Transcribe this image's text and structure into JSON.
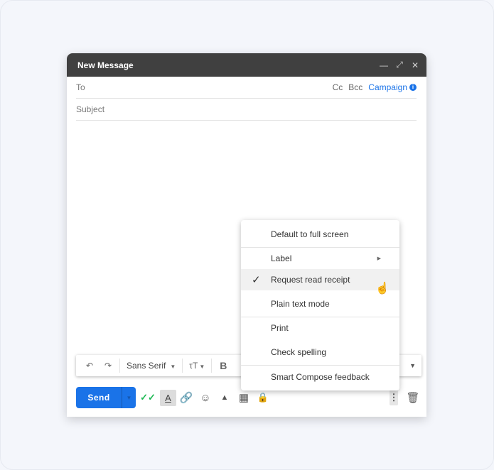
{
  "window": {
    "title": "New Message",
    "controls": [
      "minimize-icon",
      "fullscreen-icon",
      "close-icon"
    ]
  },
  "fields": {
    "to_label": "To",
    "cc": "Cc",
    "bcc": "Bcc",
    "campaign": "Campaign",
    "subject_placeholder": "Subject"
  },
  "format_toolbar": {
    "font": "Sans Serif",
    "bold": "B"
  },
  "bottom_toolbar": {
    "send_label": "Send"
  },
  "menu": {
    "items": [
      {
        "label": "Default to full screen"
      },
      {
        "label": "Label",
        "has_submenu": true
      },
      {
        "label": "Request read receipt",
        "checked": true,
        "hovered": true
      },
      {
        "label": "Plain text mode"
      },
      {
        "label": "Print"
      },
      {
        "label": "Check spelling"
      },
      {
        "label": "Smart Compose feedback"
      }
    ]
  },
  "colors": {
    "accent": "#1a73e8",
    "titlebar": "#404040",
    "check_green": "#1db954"
  }
}
